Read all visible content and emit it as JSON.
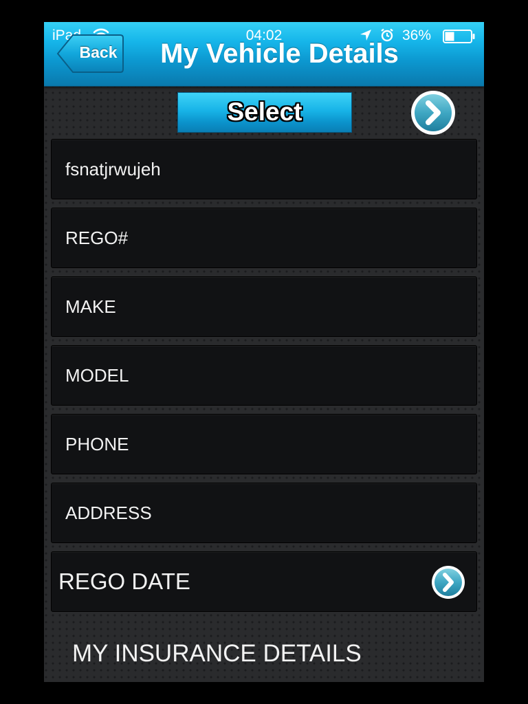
{
  "status_bar": {
    "carrier": "iPad",
    "time": "04:02",
    "battery_percent": "36%",
    "battery_level": 0.36,
    "icons": [
      "wifi-icon",
      "location-arrow-icon",
      "alarm-clock-icon",
      "battery-icon"
    ]
  },
  "nav": {
    "back_label": "Back",
    "title": "My Vehicle Details"
  },
  "toolbar": {
    "select_label": "Select",
    "next_icon": "chevron-right-circle-icon"
  },
  "fields": [
    {
      "key": "name",
      "value": "fsnatjrwujeh"
    },
    {
      "key": "rego",
      "placeholder": "REGO#"
    },
    {
      "key": "make",
      "placeholder": "MAKE"
    },
    {
      "key": "model",
      "placeholder": "MODEL"
    },
    {
      "key": "phone",
      "placeholder": "PHONE"
    },
    {
      "key": "address",
      "placeholder": "ADDRESS"
    }
  ],
  "rego_date": {
    "label": "REGO DATE",
    "icon": "chevron-right-circle-icon"
  },
  "insurance_section": {
    "heading": "MY INSURANCE DETAILS"
  },
  "colors": {
    "nav_bar_accent": "#16b6ea",
    "field_background": "#111214",
    "page_background": "#2a2b2d"
  }
}
